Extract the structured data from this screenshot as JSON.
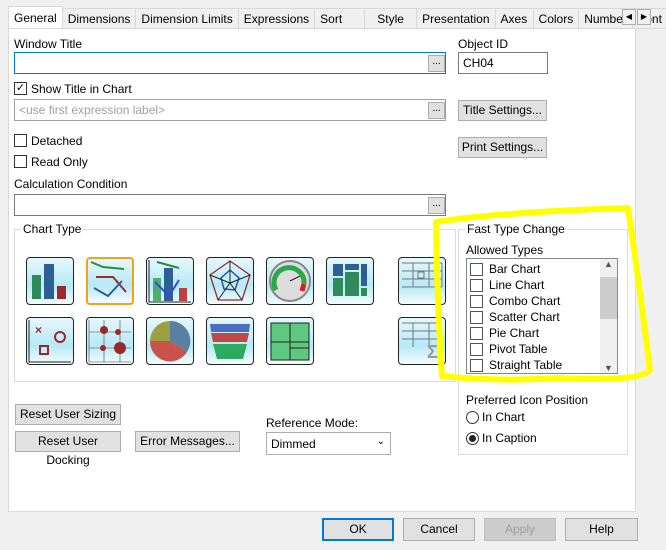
{
  "tabs": [
    "General",
    "Dimensions",
    "Dimension Limits",
    "Expressions",
    "Sort",
    "Style",
    "Presentation",
    "Axes",
    "Colors",
    "Number",
    "Font"
  ],
  "general": {
    "window_title_label": "Window Title",
    "window_title_value": "",
    "object_id_label": "Object ID",
    "object_id_value": "CH04",
    "show_title_label": "Show Title in Chart",
    "show_title_checked": true,
    "title_placeholder": "<use first expression label>",
    "title_settings": "Title Settings...",
    "detached_label": "Detached",
    "read_only_label": "Read Only",
    "print_settings": "Print Settings...",
    "calc_condition_label": "Calculation Condition",
    "ellipsis": "...",
    "chart_type_label": "Chart Type",
    "chart_types": [
      "bar-chart-icon",
      "line-chart-icon",
      "combo-chart-icon",
      "radar-chart-icon",
      "gauge-chart-icon",
      "mekko-chart-icon",
      "pivot-table-icon",
      "scatter-chart-icon",
      "grid-chart-icon",
      "pie-chart-icon",
      "funnel-chart-icon",
      "block-chart-icon",
      "straight-table-icon"
    ],
    "selected_chart_type": "line-chart-icon",
    "fast_type_change_label": "Fast Type Change",
    "allowed_types_label": "Allowed Types",
    "allowed_types": [
      "Bar Chart",
      "Line Chart",
      "Combo Chart",
      "Scatter Chart",
      "Pie Chart",
      "Pivot Table",
      "Straight Table"
    ],
    "preferred_icon_label": "Preferred Icon Position",
    "icon_positions": [
      "In Chart",
      "In Caption"
    ],
    "selected_icon_position": "In Caption",
    "reset_user_sizing": "Reset User Sizing",
    "reset_user_docking": "Reset User Docking",
    "error_messages": "Error Messages...",
    "reference_mode_label": "Reference Mode:",
    "reference_mode_value": "Dimmed",
    "highlight_color": "#ffff00"
  },
  "footer": {
    "ok": "OK",
    "cancel": "Cancel",
    "apply": "Apply",
    "help": "Help"
  }
}
